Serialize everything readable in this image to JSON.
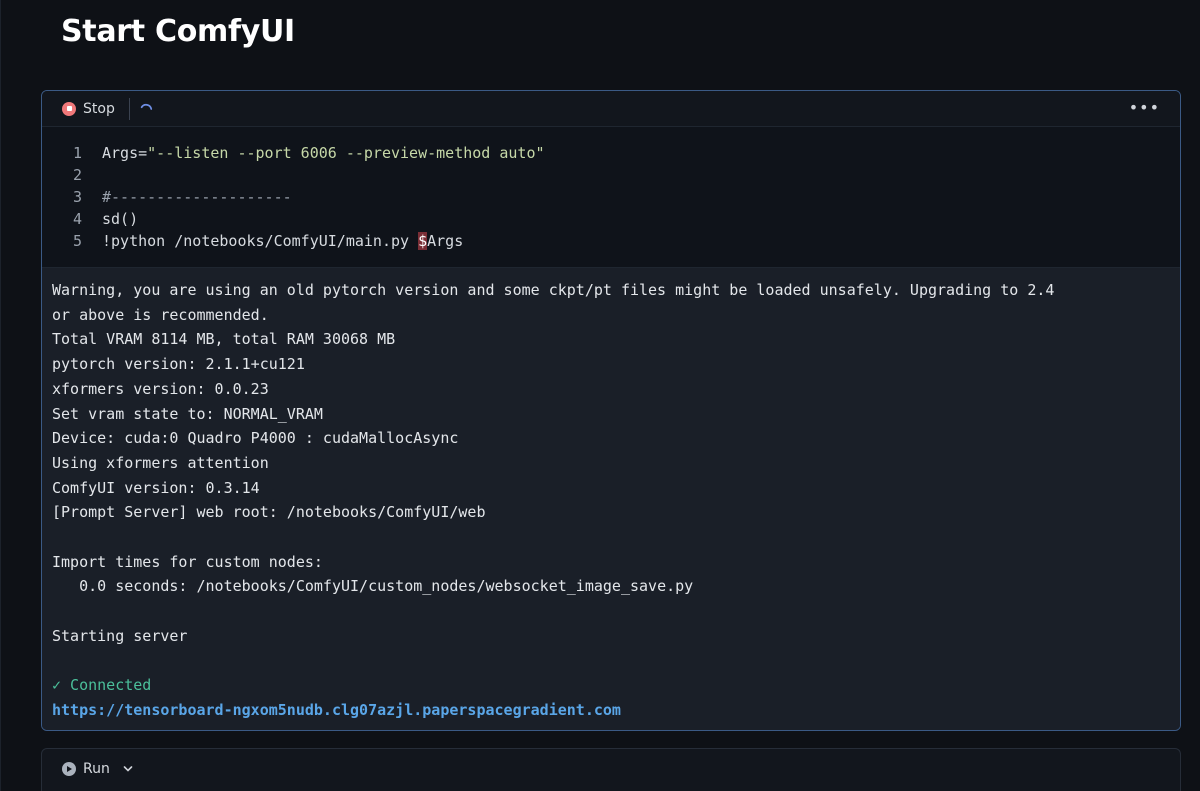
{
  "page": {
    "title": "Start ComfyUI"
  },
  "cell": {
    "toolbar": {
      "stop_label": "Stop",
      "more_label": "•••"
    },
    "code_lines": [
      {
        "num": "1",
        "prefix": "Args=",
        "string": "\"--listen --port 6006 --preview-method auto\"",
        "comment": "",
        "plain": "",
        "highlight": "",
        "suffix": ""
      },
      {
        "num": "2",
        "prefix": "",
        "string": "",
        "comment": "",
        "plain": "",
        "highlight": "",
        "suffix": ""
      },
      {
        "num": "3",
        "prefix": "",
        "string": "",
        "comment": "#--------------------",
        "plain": "",
        "highlight": "",
        "suffix": ""
      },
      {
        "num": "4",
        "prefix": "",
        "string": "",
        "comment": "",
        "plain": "sd()",
        "highlight": "",
        "suffix": ""
      },
      {
        "num": "5",
        "prefix": "",
        "string": "",
        "comment": "",
        "plain": "!python /notebooks/ComfyUI/main.py ",
        "highlight": "$",
        "suffix": "Args"
      }
    ],
    "output": {
      "lines": [
        "Warning, you are using an old pytorch version and some ckpt/pt files might be loaded unsafely. Upgrading to 2.4",
        "or above is recommended.",
        "Total VRAM 8114 MB, total RAM 30068 MB",
        "pytorch version: 2.1.1+cu121",
        "xformers version: 0.0.23",
        "Set vram state to: NORMAL_VRAM",
        "Device: cuda:0 Quadro P4000 : cudaMallocAsync",
        "Using xformers attention",
        "ComfyUI version: 0.3.14",
        "[Prompt Server] web root: /notebooks/ComfyUI/web",
        "",
        "Import times for custom nodes:",
        "   0.0 seconds: /notebooks/ComfyUI/custom_nodes/websocket_image_save.py",
        "",
        "Starting server",
        ""
      ],
      "connected": "✓ Connected",
      "url": "https://tensorboard-ngxom5nudb.clg07azjl.paperspacegradient.com"
    }
  },
  "next_cell": {
    "run_label": "Run",
    "chevron": "⌄"
  },
  "colors": {
    "accent_border": "#3b5a85",
    "stop_red": "#f0787a",
    "connected_green": "#4bbf9a",
    "link_blue": "#5aa6e8"
  }
}
